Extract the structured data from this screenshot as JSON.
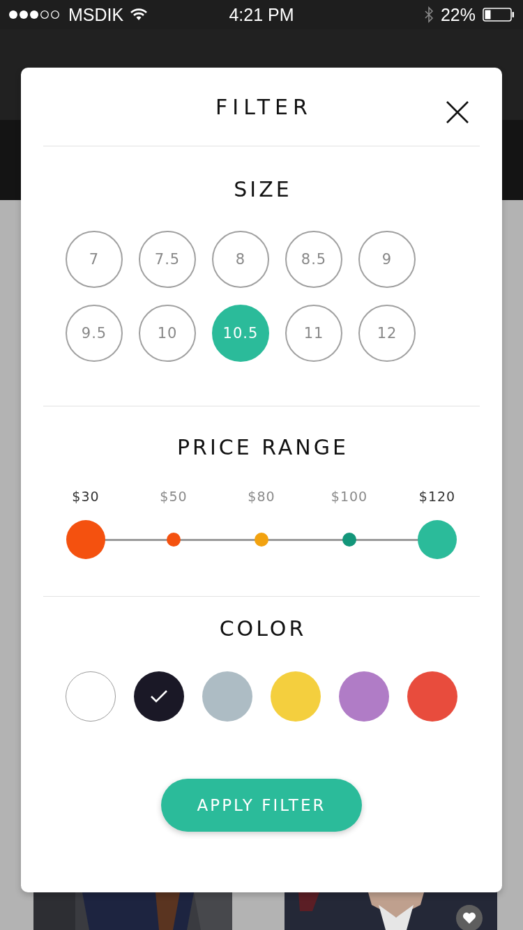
{
  "status_bar": {
    "carrier": "MSDIK",
    "time": "4:21 PM",
    "battery": "22%"
  },
  "filter": {
    "title": "FILTER",
    "size": {
      "heading": "SIZE",
      "items": [
        {
          "label": "7",
          "selected": false
        },
        {
          "label": "7.5",
          "selected": false
        },
        {
          "label": "8",
          "selected": false
        },
        {
          "label": "8.5",
          "selected": false
        },
        {
          "label": "9",
          "selected": false
        },
        {
          "label": "9.5",
          "selected": false
        },
        {
          "label": "10",
          "selected": false
        },
        {
          "label": "10.5",
          "selected": true
        },
        {
          "label": "11",
          "selected": false
        },
        {
          "label": "12",
          "selected": false
        }
      ]
    },
    "price": {
      "heading": "PRICE RANGE",
      "stops": [
        {
          "label": "$30",
          "kind": "handle",
          "color": "#f4510f"
        },
        {
          "label": "$50",
          "kind": "stop",
          "color": "#f4510f"
        },
        {
          "label": "$80",
          "kind": "stop",
          "color": "#f2a20f"
        },
        {
          "label": "$100",
          "kind": "stop",
          "color": "#13967a"
        },
        {
          "label": "$120",
          "kind": "handle",
          "color": "#2bbb9a"
        }
      ]
    },
    "color": {
      "heading": "COLOR",
      "swatches": [
        {
          "color": "#ffffff",
          "selected": false
        },
        {
          "color": "#1a1826",
          "selected": true
        },
        {
          "color": "#adbcc4",
          "selected": false
        },
        {
          "color": "#f4cf3e",
          "selected": false
        },
        {
          "color": "#b07cc6",
          "selected": false
        },
        {
          "color": "#e84c3d",
          "selected": false
        }
      ]
    },
    "apply_button": "APPLY FILTER"
  }
}
